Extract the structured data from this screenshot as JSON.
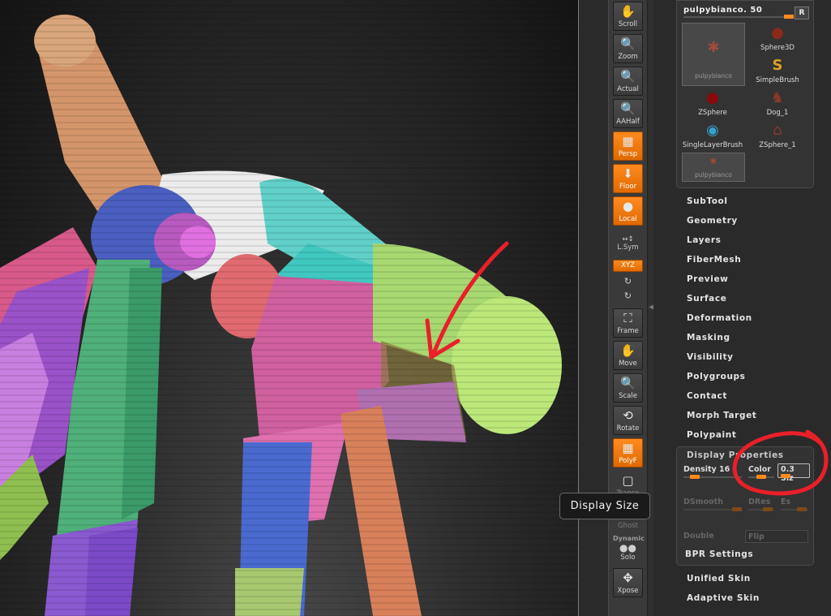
{
  "shelf": {
    "scroll": "Scroll",
    "zoom": "Zoom",
    "actual": "Actual",
    "aahalf": "AAHalf",
    "persp": "Persp",
    "floor": "Floor",
    "local": "Local",
    "lsym": "L.Sym",
    "xyz": "XYZ",
    "frame": "Frame",
    "move": "Move",
    "scale": "Scale",
    "rotate": "Rotate",
    "polyf": "PolyF",
    "transp": "Transp",
    "ghost": "Ghost",
    "dynamic": "Dynamic",
    "solo": "Solo",
    "xpose": "Xpose"
  },
  "tool": {
    "name": "pulpybianco. 50",
    "r_label": "R",
    "items": [
      {
        "label": "pulpybianco",
        "icon": "pose-thumbnail"
      },
      {
        "label": "Sphere3D",
        "icon": "sphere-icon"
      },
      {
        "label": "SimpleBrush",
        "icon": "simplebrush-icon"
      },
      {
        "label": "ZSphere",
        "icon": "zsphere-icon"
      },
      {
        "label": "Dog_1",
        "icon": "dog-icon"
      },
      {
        "label": "SingleLayerBrush",
        "icon": "singlelayerbrush-icon"
      },
      {
        "label": "ZSphere_1",
        "icon": "zsphere-icon"
      },
      {
        "label": "pulpybianco",
        "icon": "pose-thumbnail"
      }
    ]
  },
  "menu": [
    "SubTool",
    "Geometry",
    "Layers",
    "FiberMesh",
    "Preview",
    "Surface",
    "Deformation",
    "Masking",
    "Visibility",
    "Polygroups",
    "Contact",
    "Morph Target",
    "Polypaint"
  ],
  "display": {
    "title": "Display Properties",
    "density": "Density 16",
    "color": "Color",
    "size": "0.3 Siz",
    "dsmooth": "DSmooth",
    "dres": "DRes",
    "es": "Es",
    "double": "Double",
    "flip": "Flip",
    "bpr": "BPR Settings"
  },
  "menu2": [
    "Unified Skin",
    "Adaptive Skin"
  ],
  "tooltip": "Display Size",
  "colors": {
    "accent": "#ff8a1f",
    "annotation": "#e8202a"
  }
}
